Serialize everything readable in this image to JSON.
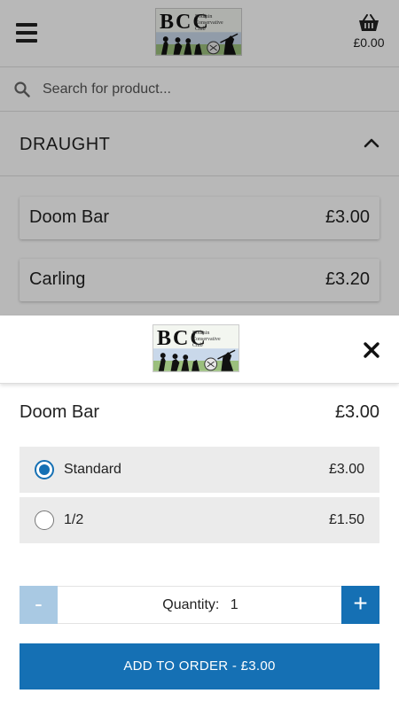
{
  "header": {
    "basket_total": "£0.00"
  },
  "search": {
    "placeholder": "Search for product..."
  },
  "section": {
    "title": "DRAUGHT"
  },
  "products": [
    {
      "name": "Doom Bar",
      "price": "£3.00"
    },
    {
      "name": "Carling",
      "price": "£3.20"
    }
  ],
  "modal": {
    "item_name": "Doom Bar",
    "item_price": "£3.00",
    "options": [
      {
        "label": "Standard",
        "price": "£3.00",
        "selected": true
      },
      {
        "label": "1/2",
        "price": "£1.50",
        "selected": false
      }
    ],
    "quantity_label": "Quantity:",
    "quantity_value": "1",
    "minus_label": "-",
    "plus_label": "+",
    "add_label": "ADD TO ORDER  -  £3.00"
  },
  "logo": {
    "letters": "BCC",
    "subtitle": "Bodmin Conservative Club"
  },
  "colors": {
    "accent": "#1570b4",
    "accent_disabled": "#a9c9e3",
    "option_bg": "#ebebeb"
  }
}
